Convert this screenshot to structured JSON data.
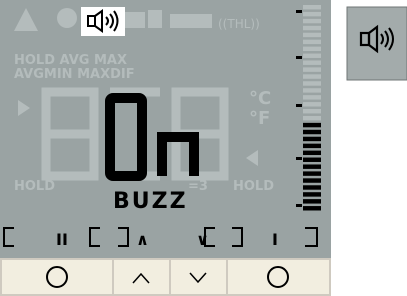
{
  "colors": {
    "lcd_background": "#9aa3a3",
    "segment_off": "#b4bcbc",
    "segment_on": "#000000",
    "button_background": "#f2eee0",
    "icon_background": "#a3abab"
  },
  "display": {
    "main_reading": "On",
    "sub_label": "BUZZ",
    "active_icon": "speaker-icon",
    "bargraph": {
      "lit_segments": 13,
      "total_segments": 30
    }
  },
  "ghost_segments": {
    "mode_row_1": "HOLD AVG MAX",
    "mode_row_2": "AVGMIN  MAXDIF",
    "unit_c": "°C",
    "unit_f": "°F",
    "hold_right": "HOLD",
    "left_small": "do\nDo",
    "unit_label": "=3"
  },
  "softkey_labels": {
    "left": "II",
    "center_left": "∧",
    "center_right": "∨",
    "right": "I"
  },
  "buttons": [
    {
      "name": "left-softkey-button",
      "icon": "circle-icon"
    },
    {
      "name": "up-arrow-button",
      "icon": "chevron-up-icon"
    },
    {
      "name": "down-arrow-button",
      "icon": "chevron-down-icon"
    },
    {
      "name": "right-softkey-button",
      "icon": "circle-icon"
    }
  ],
  "side_icon": "speaker-icon"
}
